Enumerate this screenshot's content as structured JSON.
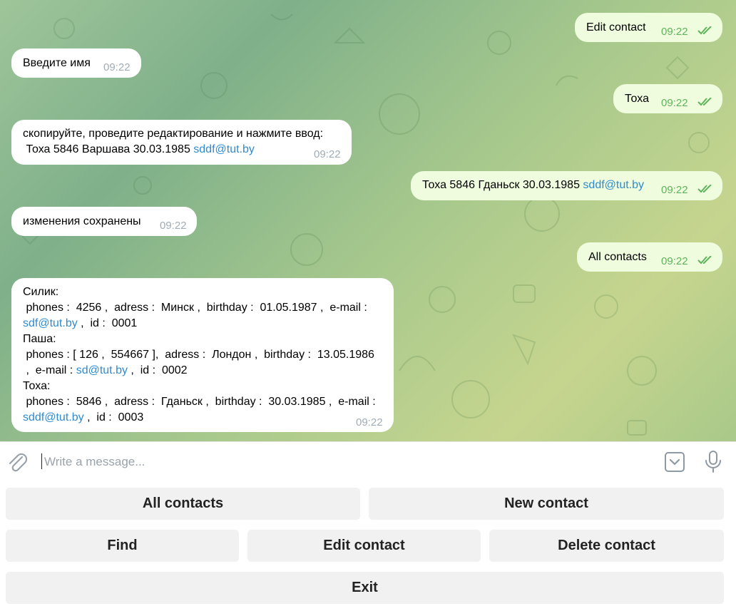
{
  "messages": {
    "out_edit_contact": {
      "text": "Edit contact",
      "time": "09:22"
    },
    "in_enter_name": {
      "text": "Введите имя",
      "time": "09:22"
    },
    "out_toxa": {
      "text": "Тоха",
      "time": "09:22"
    },
    "in_copy_edit": {
      "line1": "скопируйте, проведите редактирование и нажмите ввод:",
      "line2": " Тоха 5846 Варшава 30.03.1985 ",
      "link": "sddf@tut.by",
      "time": "09:22"
    },
    "out_toxa_full": {
      "text": "Тоха 5846 Гданьск 30.03.1985 ",
      "link": "sddf@tut.by",
      "time": "09:22"
    },
    "in_saved": {
      "text": "изменения сохранены",
      "time": "09:22"
    },
    "out_all_contacts": {
      "text": "All contacts",
      "time": "09:22"
    },
    "in_contacts_list": {
      "l1": "Силик:",
      "l2": " phones :  4256 ,  adress :  Минск ,  birthday :  01.05.1987 ,  e-mail :",
      "l3_link": "sdf@tut.by",
      "l3_rest": " ,  id :  0001",
      "l4": "Паша:",
      "l5": " phones : [ 126 ,  554667 ],  adress :  Лондон ,  birthday :  13.05.1986",
      "l6_pre": " ,  e-mail : ",
      "l6_link": "sd@tut.by",
      "l6_rest": " ,  id :  0002",
      "l7": "Тоха:",
      "l8": " phones :  5846 ,  adress :  Гданьск ,  birthday :  30.03.1985 ,  e-mail :",
      "l9_link": "sddf@tut.by",
      "l9_rest": " ,  id :  0003",
      "time": "09:22"
    }
  },
  "composer": {
    "placeholder": "Write a message..."
  },
  "keyboard": {
    "all_contacts": "All contacts",
    "new_contact": "New contact",
    "find": "Find",
    "edit_contact": "Edit contact",
    "delete_contact": "Delete contact",
    "exit": "Exit"
  },
  "icons": {
    "attach": "paperclip-icon",
    "commands": "keyboard-toggle-icon",
    "voice": "microphone-icon",
    "read": "double-check-icon"
  },
  "colors": {
    "outgoing": "#effdde",
    "incoming": "#ffffff",
    "link": "#2e8bd0",
    "check": "#5fb45b"
  }
}
